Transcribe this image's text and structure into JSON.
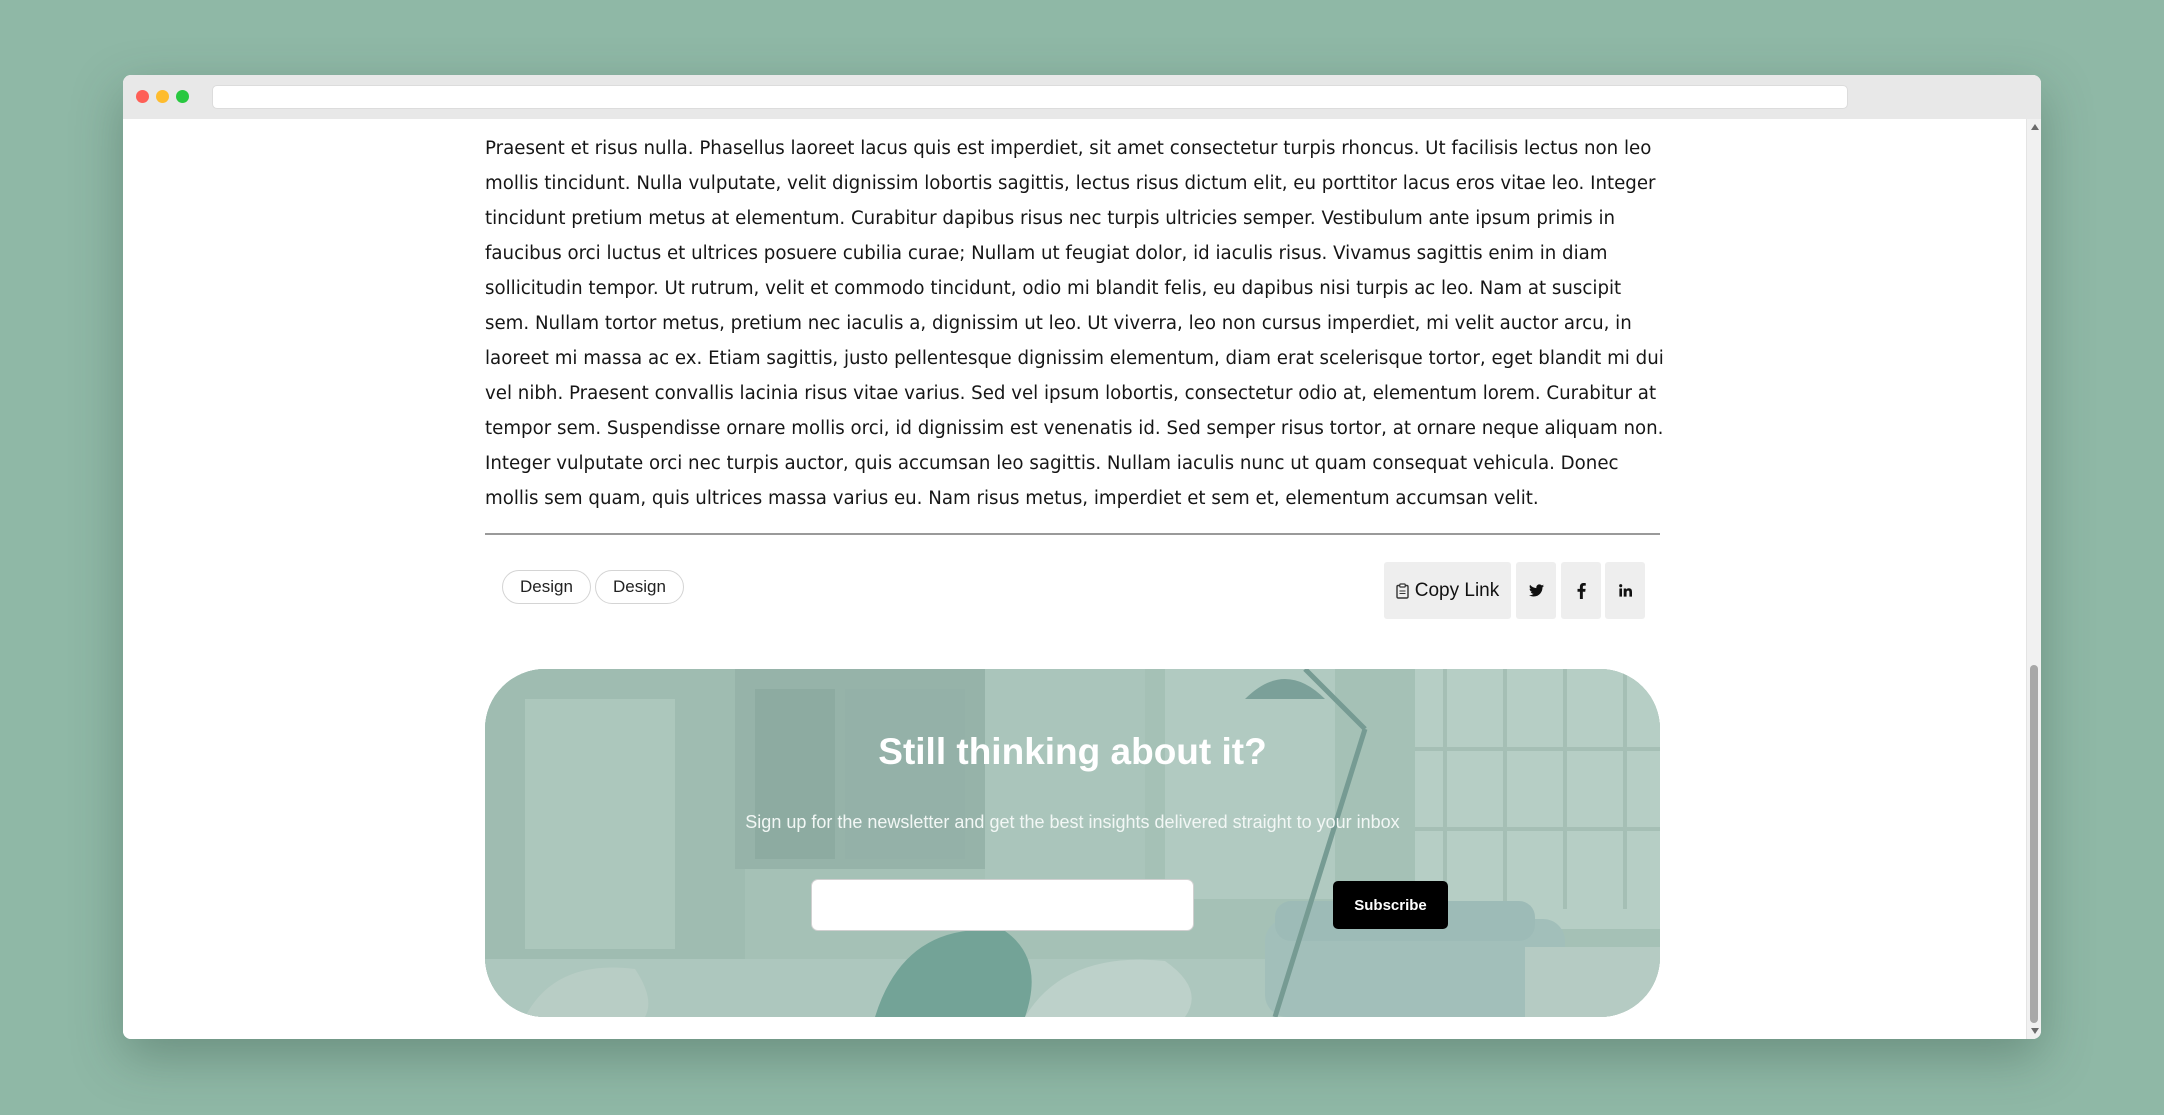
{
  "browser": {
    "url": ""
  },
  "article": {
    "body": "Praesent et risus nulla. Phasellus laoreet lacus quis est imperdiet, sit amet consectetur turpis rhoncus. Ut facilisis lectus non leo mollis tincidunt. Nulla vulputate, velit dignissim lobortis sagittis, lectus risus dictum elit, eu porttitor lacus eros vitae leo. Integer tincidunt pretium metus at elementum. Curabitur dapibus risus nec turpis ultricies semper. Vestibulum ante ipsum primis in faucibus orci luctus et ultrices posuere cubilia curae; Nullam ut feugiat dolor, id iaculis risus. Vivamus sagittis enim in diam sollicitudin tempor. Ut rutrum, velit et commodo tincidunt, odio mi blandit felis, eu dapibus nisi turpis ac leo. Nam at suscipit sem. Nullam tortor metus, pretium nec iaculis a, dignissim ut leo. Ut viverra, leo non cursus imperdiet, mi velit auctor arcu, in laoreet mi massa ac ex. Etiam sagittis, justo pellentesque dignissim elementum, diam erat scelerisque tortor, eget blandit mi dui vel nibh. Praesent convallis lacinia risus vitae varius. Sed vel ipsum lobortis, consectetur odio at, elementum lorem. Curabitur at tempor sem. Suspendisse ornare mollis orci, id dignissim est venenatis id. Sed semper risus tortor, at ornare neque aliquam non. Integer vulputate orci nec turpis auctor, quis accumsan leo sagittis. Nullam iaculis nunc ut quam consequat vehicula. Donec mollis sem quam, quis ultrices massa varius eu. Nam risus metus, imperdiet et sem et, elementum accumsan velit."
  },
  "tags": [
    "Design",
    "Design"
  ],
  "share": {
    "copy_link_label": "Copy Link",
    "copy_icon": "clipboard-icon",
    "twitter_icon": "twitter-icon",
    "facebook_icon": "facebook-icon",
    "linkedin_icon": "linkedin-icon"
  },
  "newsletter": {
    "title": "Still thinking about it?",
    "subtitle": "Sign up for the newsletter and get the best insights delivered straight to your inbox",
    "email_value": "",
    "subscribe_label": "Subscribe"
  },
  "colors": {
    "page_background": "#8fb8a6",
    "subscribe_button": "#000000",
    "newsletter_tint": "#9cbcb0"
  }
}
